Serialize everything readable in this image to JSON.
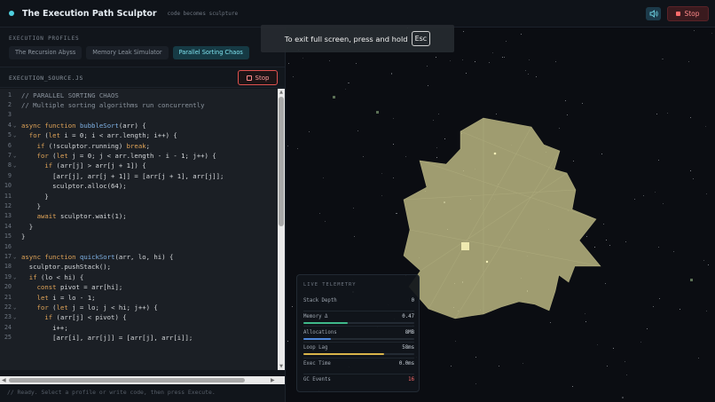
{
  "header": {
    "title": "The Execution Path Sculptor",
    "tagline": "code becomes sculpture",
    "stop_label": "Stop",
    "sound_icon": "speaker-icon"
  },
  "profiles": {
    "section_label": "EXECUTION PROFILES",
    "items": [
      {
        "label": "The Recursion Abyss",
        "active": false
      },
      {
        "label": "Memory Leak Simulator",
        "active": false
      },
      {
        "label": "Parallel Sorting Chaos",
        "active": true
      }
    ]
  },
  "editor": {
    "filename": "EXECUTION_SOURCE.JS",
    "stop_label": "Stop",
    "lines": [
      {
        "n": "1",
        "fold": false,
        "text": "// PARALLEL SORTING CHAOS",
        "kind": "com"
      },
      {
        "n": "2",
        "fold": false,
        "text": "// Multiple sorting algorithms run concurrently",
        "kind": "com"
      },
      {
        "n": "3",
        "fold": false,
        "text": "",
        "kind": "plain"
      },
      {
        "n": "4",
        "fold": true,
        "text": "async function bubbleSort(arr) {",
        "kind": "fn"
      },
      {
        "n": "5",
        "fold": true,
        "text": "  for (let i = 0; i < arr.length; i++) {",
        "kind": "kw"
      },
      {
        "n": "6",
        "fold": false,
        "text": "    if (!sculptor.running) break;",
        "kind": "kw"
      },
      {
        "n": "7",
        "fold": true,
        "text": "    for (let j = 0; j < arr.length - i - 1; j++) {",
        "kind": "kw"
      },
      {
        "n": "8",
        "fold": true,
        "text": "      if (arr[j] > arr[j + 1]) {",
        "kind": "kw"
      },
      {
        "n": "9",
        "fold": false,
        "text": "        [arr[j], arr[j + 1]] = [arr[j + 1], arr[j]];",
        "kind": "plain"
      },
      {
        "n": "10",
        "fold": false,
        "text": "        sculptor.alloc(64);",
        "kind": "plain"
      },
      {
        "n": "11",
        "fold": false,
        "text": "      }",
        "kind": "plain"
      },
      {
        "n": "12",
        "fold": false,
        "text": "    }",
        "kind": "plain"
      },
      {
        "n": "13",
        "fold": false,
        "text": "    await sculptor.wait(1);",
        "kind": "kw"
      },
      {
        "n": "14",
        "fold": false,
        "text": "  }",
        "kind": "plain"
      },
      {
        "n": "15",
        "fold": false,
        "text": "}",
        "kind": "plain"
      },
      {
        "n": "16",
        "fold": false,
        "text": "",
        "kind": "plain"
      },
      {
        "n": "17",
        "fold": true,
        "text": "async function quickSort(arr, lo, hi) {",
        "kind": "fn"
      },
      {
        "n": "18",
        "fold": false,
        "text": "  sculptor.pushStack();",
        "kind": "plain"
      },
      {
        "n": "19",
        "fold": true,
        "text": "  if (lo < hi) {",
        "kind": "kw"
      },
      {
        "n": "20",
        "fold": false,
        "text": "    const pivot = arr[hi];",
        "kind": "kw"
      },
      {
        "n": "21",
        "fold": false,
        "text": "    let i = lo - 1;",
        "kind": "kw"
      },
      {
        "n": "22",
        "fold": true,
        "text": "    for (let j = lo; j < hi; j++) {",
        "kind": "kw"
      },
      {
        "n": "23",
        "fold": true,
        "text": "      if (arr[j] < pivot) {",
        "kind": "kw"
      },
      {
        "n": "24",
        "fold": false,
        "text": "        i++;",
        "kind": "plain"
      },
      {
        "n": "25",
        "fold": false,
        "text": "        [arr[i], arr[j]] = [arr[j], arr[i]];",
        "kind": "plain"
      }
    ]
  },
  "console": {
    "message": "// Ready. Select a profile or write code, then press Execute."
  },
  "telemetry": {
    "title": "LIVE TELEMETRY",
    "rows": [
      {
        "key": "Stack Depth",
        "value": "0",
        "bar": null,
        "color": null,
        "red": false
      },
      {
        "key": "Memory Δ",
        "value": "0.47",
        "bar": 0.4,
        "color": "#3fb98a",
        "red": false
      },
      {
        "key": "Allocations",
        "value": "8MB",
        "bar": 0.25,
        "color": "#4f86d9",
        "red": false
      },
      {
        "key": "Loop Lag",
        "value": "58ms",
        "bar": 0.73,
        "color": "#d9b44a",
        "red": false
      },
      {
        "key": "Exec Time",
        "value": "0.0ms",
        "bar": null,
        "color": null,
        "red": false
      },
      {
        "key": "GC Events",
        "value": "16",
        "bar": null,
        "color": null,
        "red": true
      }
    ]
  },
  "toast": {
    "message": "To exit full screen, press and hold",
    "key": "Esc"
  },
  "colors": {
    "accent": "#4fd1e0",
    "danger": "#ff6b6b",
    "sculpture": "#c9c58a"
  }
}
